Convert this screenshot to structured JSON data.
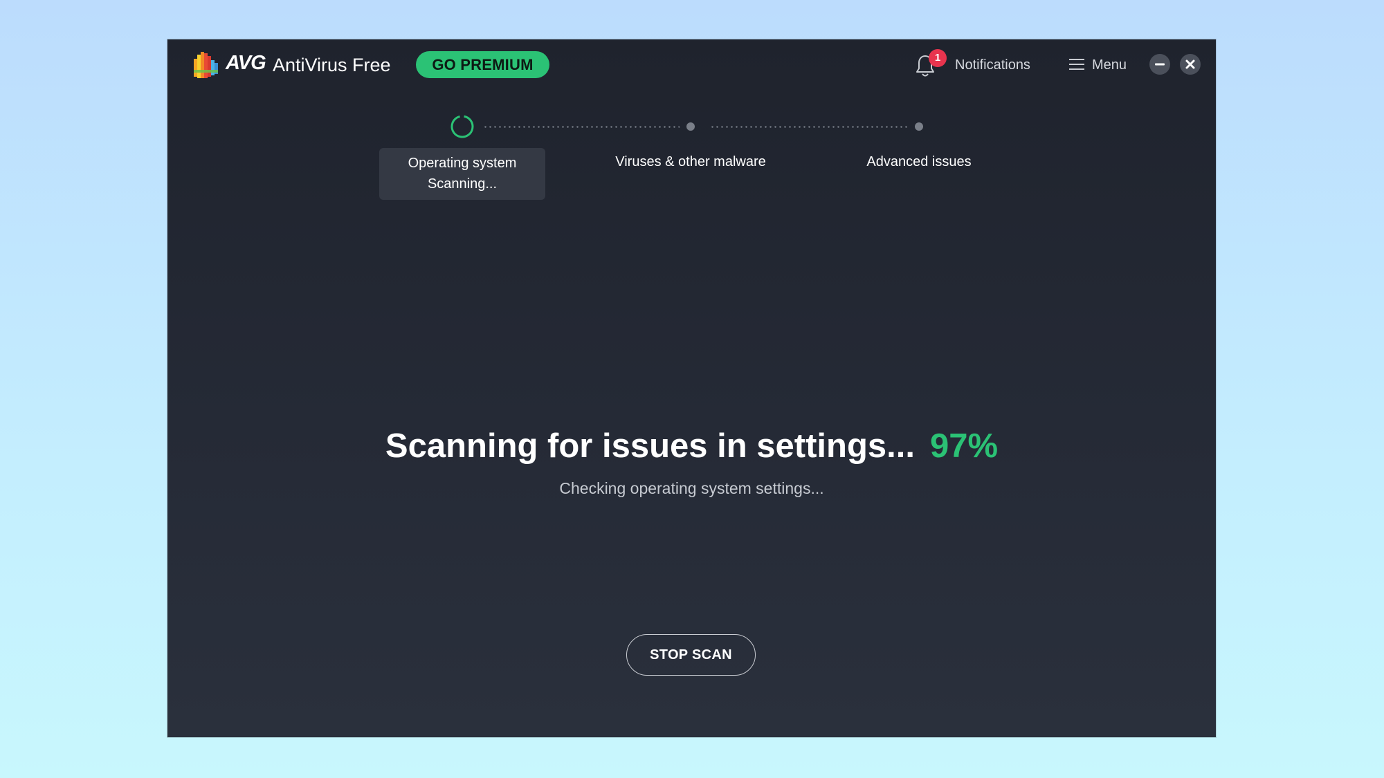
{
  "app": {
    "brand": "AVG",
    "product": "AntiVirus Free",
    "premium_button": "GO PREMIUM"
  },
  "header": {
    "notifications_label": "Notifications",
    "notifications_count": "1",
    "menu_label": "Menu"
  },
  "steps": [
    {
      "label": "Operating system",
      "status": "Scanning...",
      "state": "active"
    },
    {
      "label": "Viruses & other malware",
      "state": "pending"
    },
    {
      "label": "Advanced issues",
      "state": "pending"
    }
  ],
  "scan": {
    "headline": "Scanning for issues in settings...",
    "percent": "97%",
    "progress": 0.97,
    "detail": "Checking operating system settings...",
    "stop_button": "STOP SCAN"
  },
  "colors": {
    "accent": "#2bc275",
    "badge": "#e8344e",
    "window_bg": "#232733"
  },
  "icons": {
    "logo": "avg-logo-icon",
    "bell": "bell-icon",
    "menu": "hamburger-icon",
    "minimize": "minimize-icon",
    "close": "close-icon"
  }
}
